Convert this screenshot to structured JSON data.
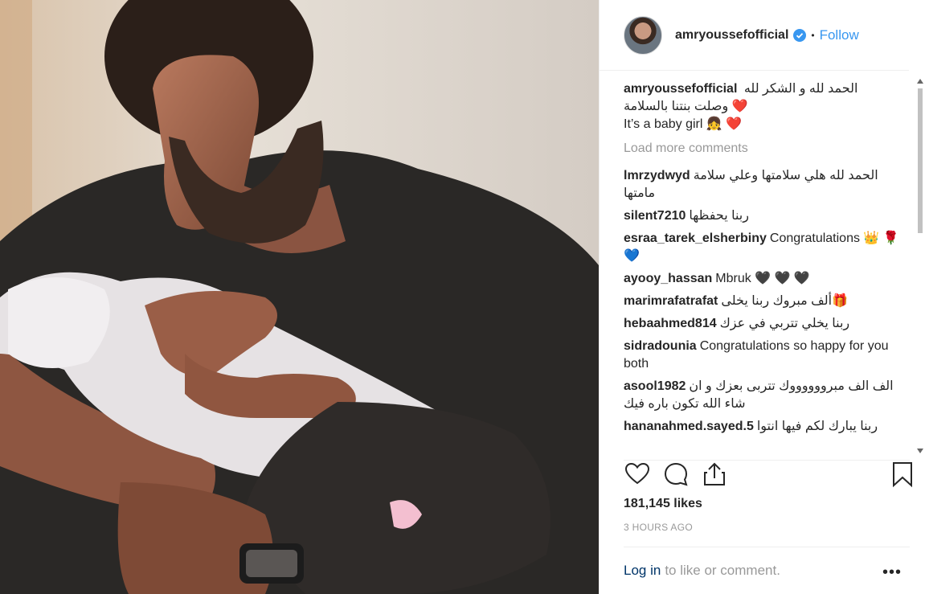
{
  "post": {
    "username": "amryoussefofficial",
    "follow_label": "Follow",
    "dot": "•",
    "caption": {
      "username": "amryoussefofficial",
      "line1": "الحمد لله و الشكر لله",
      "line2": "وصلت بنتنا بالسلامة ❤️",
      "line3": "It’s a baby girl 👧 ❤️"
    },
    "load_more": "Load more comments",
    "comments": [
      {
        "user": "lmrzydwyd",
        "text": "الحمد لله هلي سلامتها وعلي سلامة مامتها"
      },
      {
        "user": "silent7210",
        "text": "ربنا يحفظها"
      },
      {
        "user": "esraa_tarek_elsherbiny",
        "text": "Congratulations 👑 🌹💙"
      },
      {
        "user": "ayooy_hassan",
        "text": "Mbruk 🖤 🖤 🖤"
      },
      {
        "user": "marimrafatrafat",
        "text": "ألف مبروك ربنا يخلى🎁"
      },
      {
        "user": "hebaahmed814",
        "text": "ربنا يخلي تتربي في عزك"
      },
      {
        "user": "sidradounia",
        "text": "Congratulations so happy for you both"
      },
      {
        "user": "asool1982",
        "text": "الف الف مبرووووووك تتربى بعزك و ان شاء الله تكون باره فيك"
      },
      {
        "user": "hananahmed.sayed.5",
        "text": "ربنا يبارك لكم فيها انتوا"
      }
    ],
    "likes": "181,145 likes",
    "time": "3 HOURS AGO",
    "footer": {
      "login": "Log in",
      "rest": "to like or comment.",
      "more": "•••"
    }
  },
  "colors": {
    "link": "#3897f0",
    "verified": "#3897f0",
    "muted": "#999999"
  },
  "icons": [
    "verified-badge-icon",
    "heart-icon",
    "comment-icon",
    "share-icon",
    "bookmark-icon",
    "more-options-icon"
  ]
}
